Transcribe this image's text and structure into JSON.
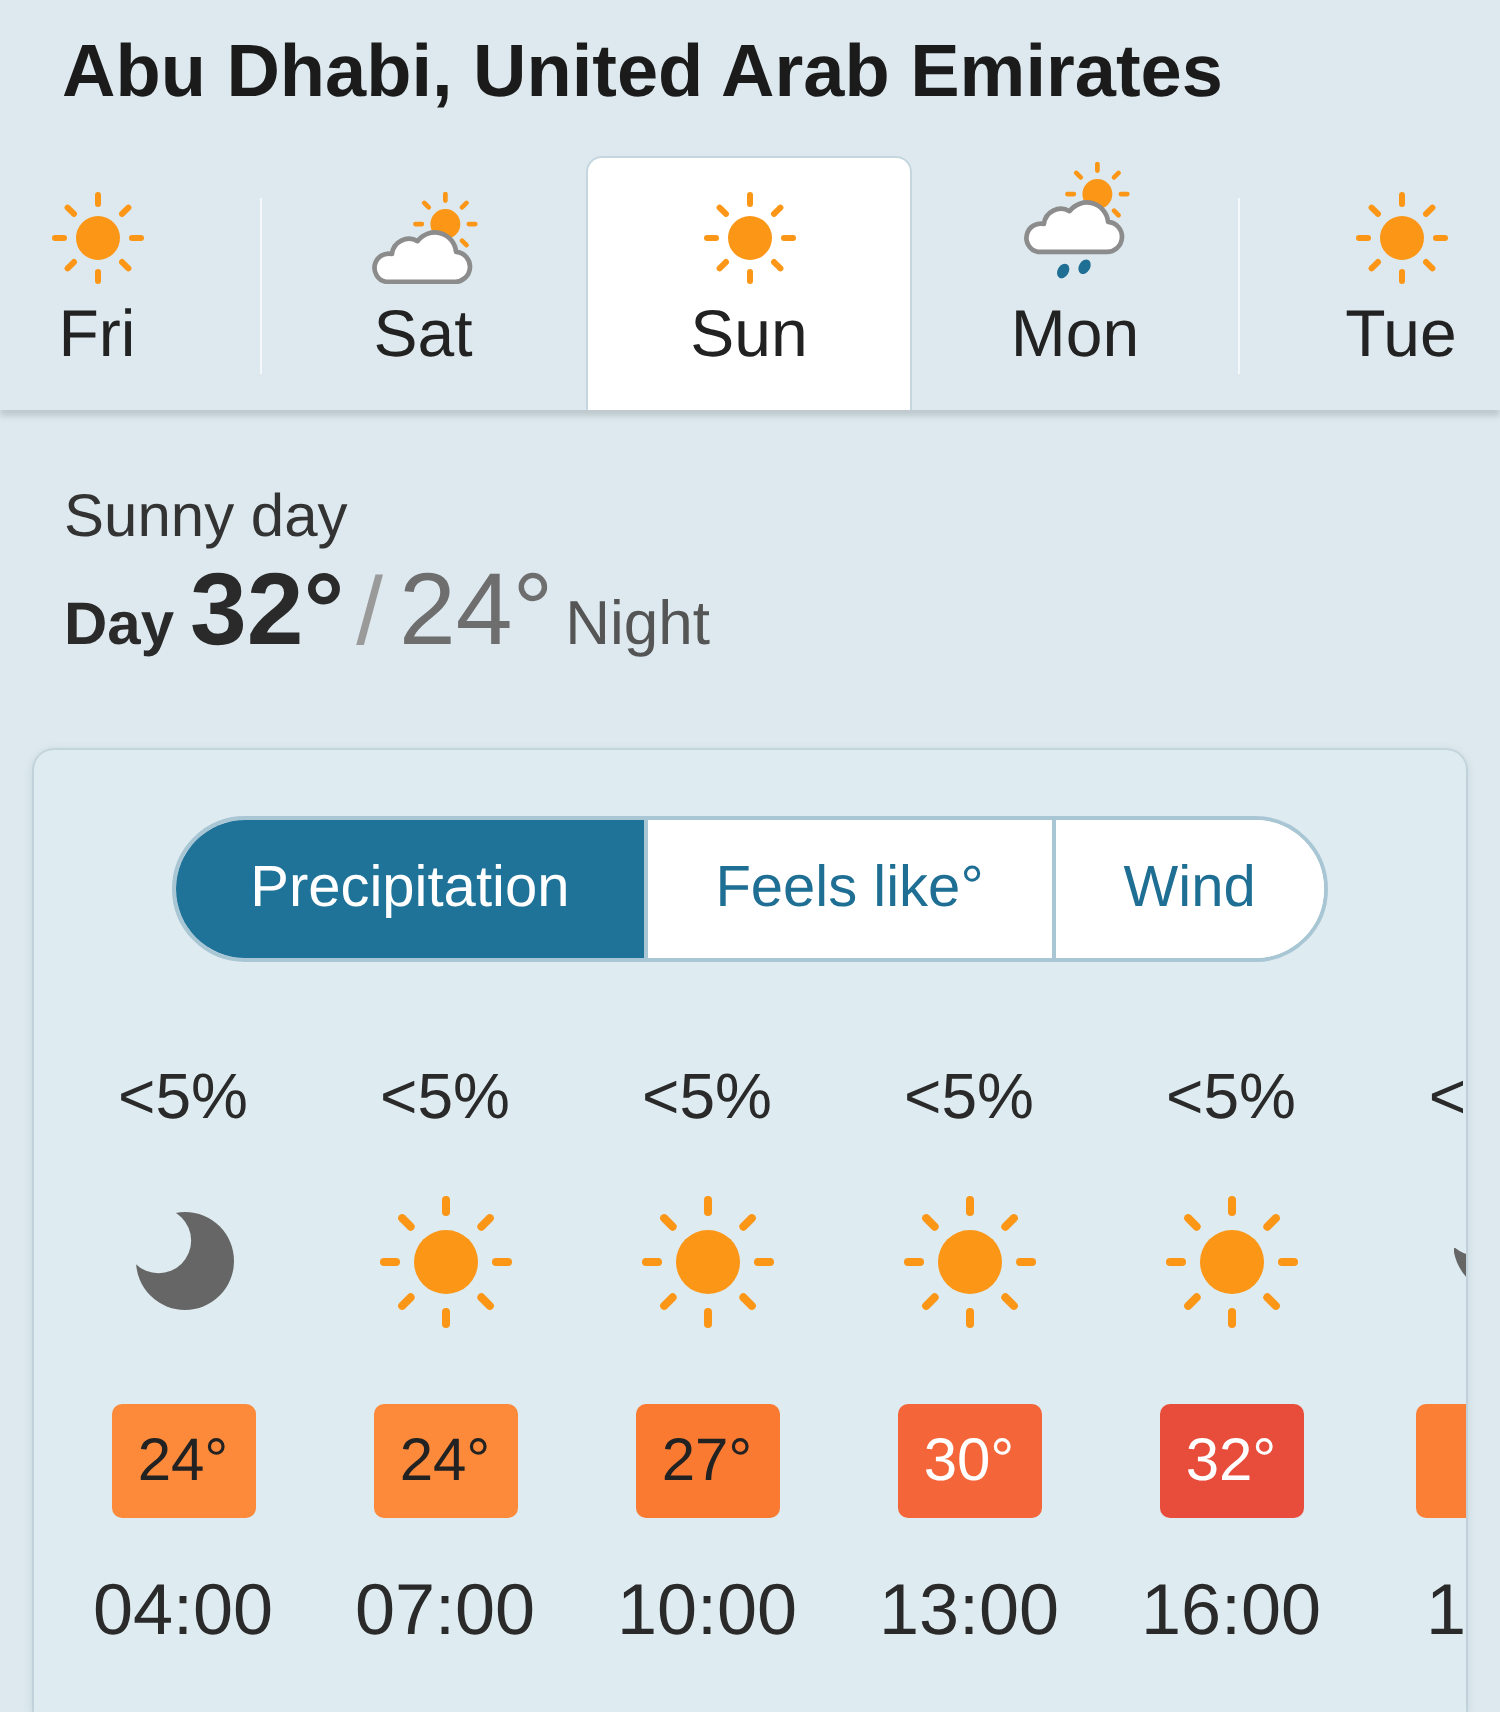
{
  "location": {
    "title": "Abu Dhabi, United Arab Emirates"
  },
  "days": [
    {
      "label": "Fri",
      "kind": "sun",
      "selected": false
    },
    {
      "label": "Sat",
      "kind": "sun-cloud",
      "selected": false
    },
    {
      "label": "Sun",
      "kind": "sun",
      "selected": true
    },
    {
      "label": "Mon",
      "kind": "sun-cloud-rain",
      "selected": false
    },
    {
      "label": "Tue",
      "kind": "sun",
      "selected": false
    }
  ],
  "summary": {
    "condition": "Sunny day",
    "day_label": "Day",
    "day_temp": "32°",
    "separator": "/",
    "night_temp": "24°",
    "night_label": "Night"
  },
  "modes": [
    {
      "label": "Precipitation",
      "selected": true
    },
    {
      "label": "Feels like°",
      "selected": false
    },
    {
      "label": "Wind",
      "selected": false
    }
  ],
  "hours": [
    {
      "precipitation": "<5%",
      "kind": "moon",
      "temp": "24°",
      "color": "#fd8a3a",
      "time": "04:00",
      "cut": false
    },
    {
      "precipitation": "<5%",
      "kind": "sun",
      "temp": "24°",
      "color": "#fd8a3a",
      "time": "07:00",
      "cut": false
    },
    {
      "precipitation": "<5%",
      "kind": "sun",
      "temp": "27°",
      "color": "#fb7a32",
      "time": "10:00",
      "cut": false
    },
    {
      "precipitation": "<5%",
      "kind": "sun",
      "temp": "30°",
      "color": "#f4663a",
      "time": "13:00",
      "cut": false
    },
    {
      "precipitation": "<5%",
      "kind": "sun",
      "temp": "32°",
      "color": "#e84c3a",
      "time": "16:00",
      "cut": false
    },
    {
      "precipitation": "<",
      "kind": "moon",
      "color": "#fb7f35",
      "time": "1",
      "cut": true
    }
  ]
}
